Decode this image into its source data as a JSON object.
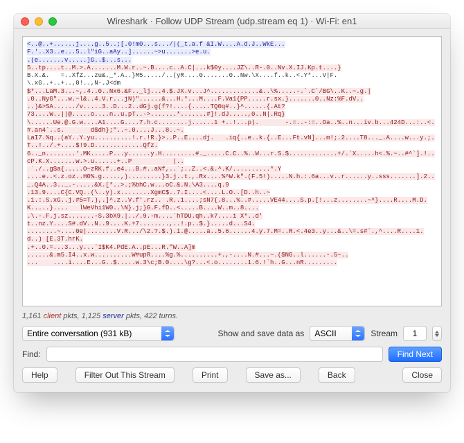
{
  "title": "Wireshark · Follow UDP Stream (udp.stream eq 1) · Wi-Fi: en1",
  "stream_lines": [
    {
      "cls": "server",
      "text": "<..@..+......j....g..5..;[.0!m0...s.../|(_t.a.f &I.W....A.d.J..WkE..."
    },
    {
      "cls": "server",
      "text": "F.'..X3..e...5..l\"iG..aAy..]......~>u.......>e.u."
    },
    {
      "cls": "server",
      "text": ".(e.......v.....]G..$...s..."
    },
    {
      "cls": "client",
      "text": "5..tp....t..M.>.A.......M.W.r..~.B....c..A.C|...k$0y....JZ\\..R-.0..Nv.X.IJ.Kp.t....}"
    },
    {
      "cls": "plain",
      "text": "B.X.&.   =..XfZ...zu&._*.A..}M5...../..(yR....0.......0..Nw.\\X....f..k..<.Y*...V|F."
    },
    {
      "cls": "plain",
      "text": "\\.xG..+..+..,0!..,N-.J<dm"
    },
    {
      "cls": "client",
      "text": "$*...LaM.3...~,.4..0..Nx6.&F.._lj...4.$.JX.v...J^.............&..\\%.....-.`.C`/BG\\..K..~.g.|"
    },
    {
      "cls": "client",
      "text": ".0..NyG\"...w.~l&..4.V.r...jN)\"......&...H.*...M....F.Va1{PP.....r.sx.}.......0..Nz:%F.dV.."
    },
    {
      "cls": "client",
      "text": "..)&>SA....../v.....3..D...2..dGj.g(f?!....{.....TQ0q#..}^......{.At?"
    },
    {
      "cls": "client",
      "text": "73....W..||@.....o....n..u.pT..->.......*.......#]!.dJ.....,0..N|.Rq}"
    },
    {
      "cls": "client",
      "text": "\\......Ue.@.G.w....A1....G....7.h.c........j......1 +..!...p).       -.=..-:=..Oa..%..n...iv.b...424D...:..<.#.an4`..s.       d$dh};\"..~.0....J...8..~."
    },
    {
      "cls": "client",
      "text": "LaI7.%q..(aY..Y.yu..........!.r.!R.}>..P..E....dj.   .iq{..e..k.{..E...Ft.vN]...m!;.2....T8..._.A....w...y.;.T..!../.+....$!9.D.............Qfz."
    },
    {
      "cls": "client",
      "text": "6.._n........'.MK.....P...y......y.H.........#._.....C.C..%..W...r.S.$.............+/.`X.....h<.%.~..#^`].!..cP.K.X.......w.>.u......+..P           |.."
    },
    {
      "cls": "client",
      "text": " `./..g$a{.....O~zRK.f..e4...B.#..aNf,..`;..Z..<.&.^.K/..........*.Y"
    },
    {
      "cls": "client",
      "text": "....e..<.z.oz..H0%.g.....,).........}3.j..t.,.Rx....%^W.k\".(F.5!).....N.h.:.6a...v..r......y..sss.......].2.._.Q4A..3.._.-.....&X.[*..>.;%bhC.w...oC.&.N.\\A3....q.9"
    },
    {
      "cls": "client",
      "text": ".13.9....C{C.VQ..(\\..y).x........XgmC$..7.I....<....L.O..[D..h..~"
    },
    {
      "cls": "client",
      "text": ".1.:.S.xG..j.#5=T.),.]^.z..V.f'.rz.. .R..1....;sN7{.8...%..#.....VE44....S.p.[!...z........~^}....R....M.D.K.....}....   lWeVhi1W0..\\N}.j;}G.F.fD..<.....B....W..m..8...."
    },
    {
      "cls": "client",
      "text": ".\\.-.F.j.sz.......-S.3bX9.|../.9.-m....`hTDU.qh..k7....i X*..d'"
    },
    {
      "cls": "client",
      "text": "t..nz.Y....S#.dV..N..9....K.+7........,..!.p..$.}.....d...S4."
    },
    {
      "cls": "client",
      "text": "........~....0e|........V.R.../\\2.?.$.).i.@.....a..5.6......4.y.7.M=..R.<.4e3..y...&..\\=.s#`.,^....R....1.d..) [E.3T.hrK."
    },
    {
      "cls": "client",
      "text": ".+..0.=...3...y...`I$K4.PdE.A..pE...R.\"W..A]m"
    },
    {
      "cls": "client",
      "text": "......&.m5.I4..x.w..........W#upR....%g.%..........+.,-....N.#...~.($NG..l......-.5~.."
    },
    {
      "cls": "client",
      "text": "...    ....i....E...G..$.....w.3\\c;B.0....\\g?...<.o........1.6.!`h..G...nR........."
    }
  ],
  "stats": {
    "pre": "1,161 ",
    "client": "client",
    "mid": " pkts, 1,125 ",
    "server": "server",
    "post": " pkts, 422 turns."
  },
  "conversation_select": "Entire conversation (931 kB)",
  "show_label": "Show and save data as",
  "format_select": "ASCII",
  "stream_label": "Stream",
  "stream_number": "1",
  "find_label": "Find:",
  "find_value": "",
  "buttons": {
    "find_next": "Find Next",
    "help": "Help",
    "filter_out": "Filter Out This Stream",
    "print": "Print",
    "save_as": "Save as...",
    "back": "Back",
    "close": "Close"
  }
}
